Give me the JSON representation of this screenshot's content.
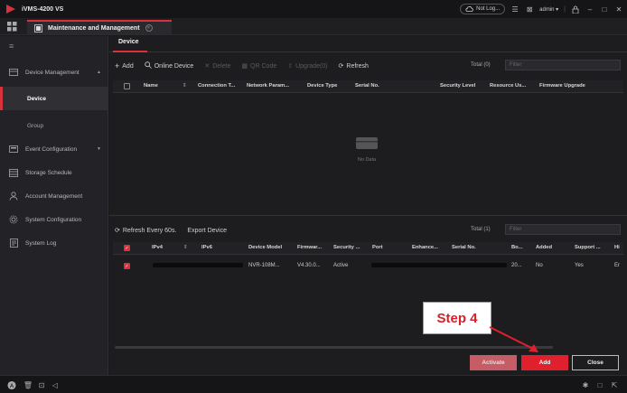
{
  "app": {
    "title": "iVMS-4200 VS"
  },
  "titlebar": {
    "status": "Not Log...",
    "user": "admin",
    "user_caret": "▾"
  },
  "tabs": {
    "main_label": "Maintenance and Management"
  },
  "sidebar": {
    "items": [
      {
        "label": "Device Management",
        "icon": "device-icon"
      },
      {
        "label": "Device",
        "active": true
      },
      {
        "label": "Group"
      },
      {
        "label": "Event Configuration",
        "icon": "event-icon"
      },
      {
        "label": "Storage Schedule",
        "icon": "storage-icon"
      },
      {
        "label": "Account Management",
        "icon": "account-icon"
      },
      {
        "label": "System Configuration",
        "icon": "system-icon"
      },
      {
        "label": "System Log",
        "icon": "log-icon"
      }
    ]
  },
  "content": {
    "subtab": "Device",
    "toolbar": {
      "add": "Add",
      "online_device": "Online Device",
      "delete": "Delete",
      "qr_code": "QR Code",
      "upgrade": "Upgrade(0)",
      "refresh": "Refresh"
    },
    "top_total": "Total (0)",
    "filter_placeholder": "Filter",
    "top_columns": [
      "Name",
      "Connection T...",
      "Network Param...",
      "Device Type",
      "Serial No.",
      "Security Level",
      "Resource Us...",
      "Firmware Upgrade"
    ],
    "no_data": "No Data",
    "bottom_toolbar": {
      "refresh_every": "Refresh Every 60s.",
      "export": "Export Device"
    },
    "bottom_total": "Total (1)",
    "bottom_columns": [
      "IPv4",
      "IPv6",
      "Device Model",
      "Firmwar...",
      "Security ...",
      "Port",
      "Enhance...",
      "Serial No.",
      "Bo...",
      "Added",
      "Support ...",
      "Hi"
    ],
    "online_rows": [
      {
        "device_model": "NVR-108M...",
        "firmware": "V4.30.0...",
        "security": "Active",
        "bo": "20...",
        "added": "No",
        "support": "Yes",
        "hi": "Er"
      }
    ],
    "buttons": {
      "activate": "Activate",
      "add": "Add",
      "close": "Close"
    }
  },
  "annotation": {
    "label": "Step 4"
  },
  "colors": {
    "accent": "#d7323e",
    "add_button": "#e0202d",
    "activate_button": "#c65d66"
  }
}
